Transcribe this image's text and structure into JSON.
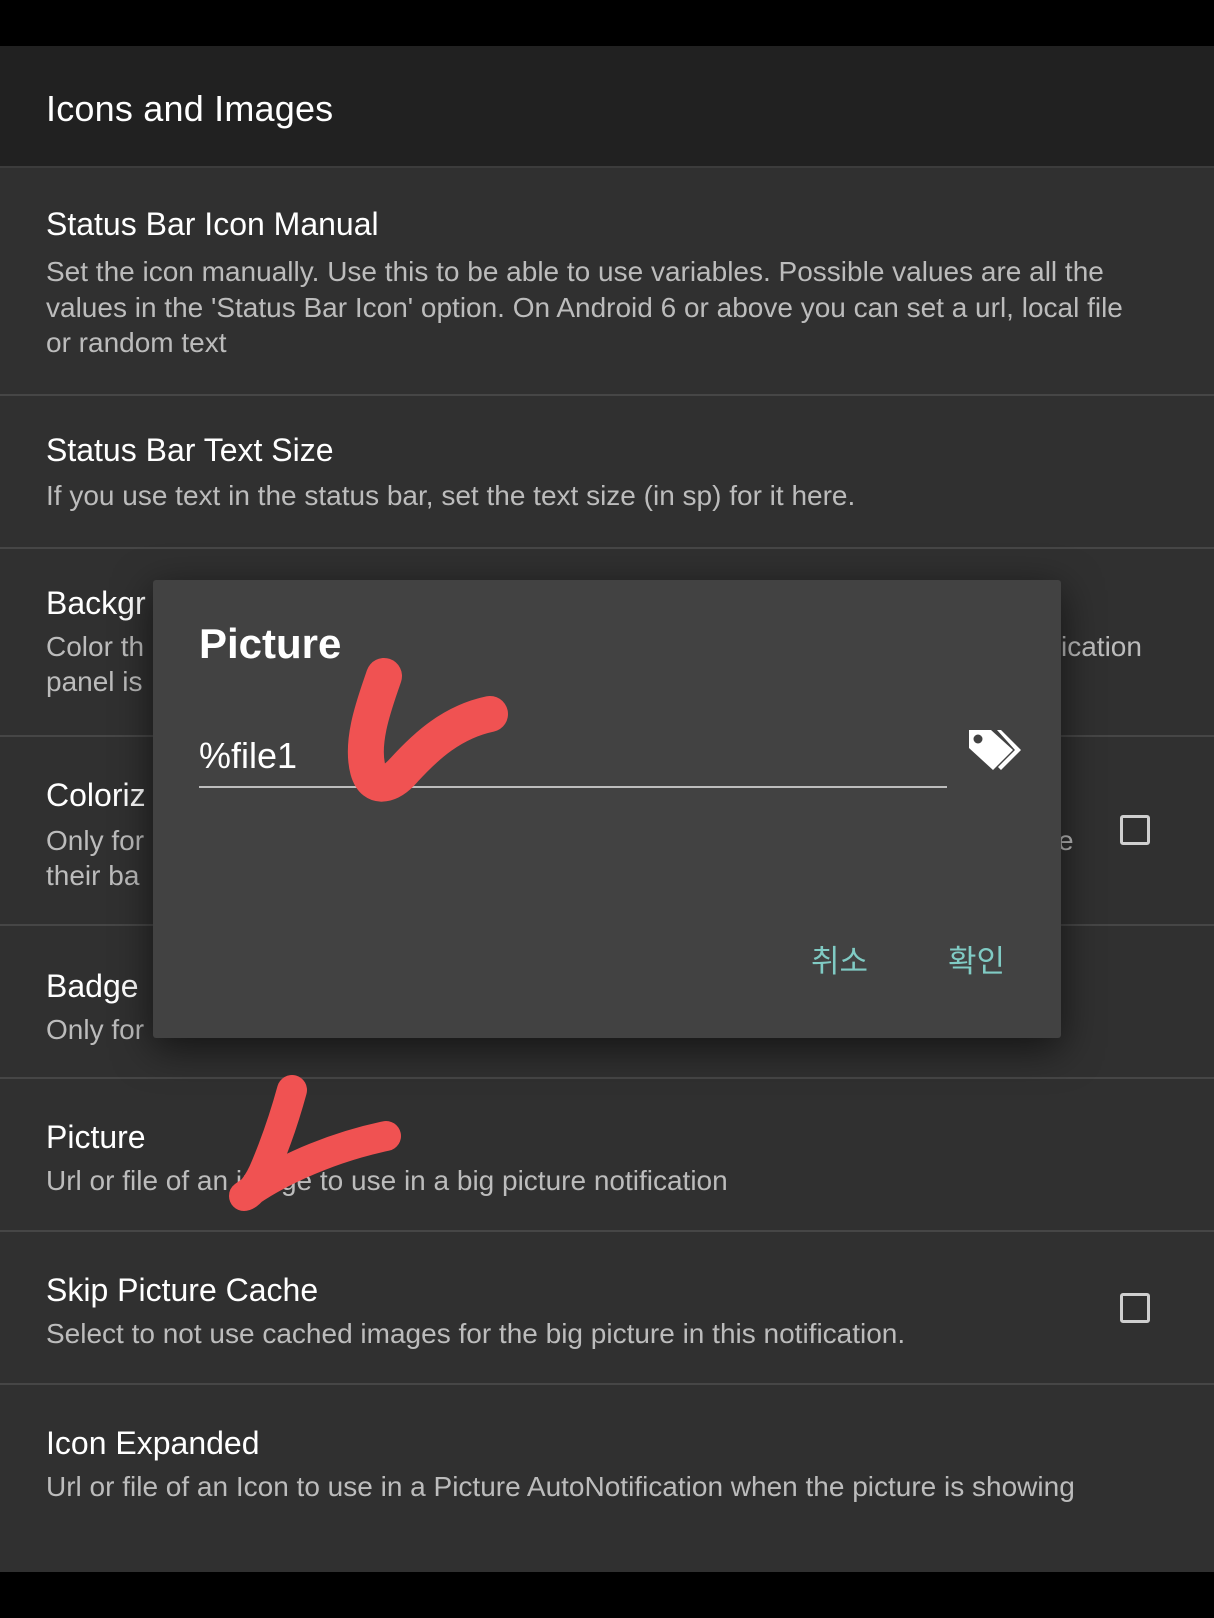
{
  "header": {
    "title": "Icons and Images"
  },
  "items": [
    {
      "title": "Status Bar Icon Manual",
      "summary": "Set the icon manually. Use this to be able to use variables. Possible values are all the values in the 'Status Bar Icon' option. On Android 6 or above you can set a url, local file or random text"
    },
    {
      "title": "Status Bar Text Size",
      "summary": "If you use text in the status bar, set the text size (in sp) for it here."
    },
    {
      "title_visible": "Backgr",
      "summary_line1_left": "Color th",
      "summary_line1_right": "ication",
      "summary_line2_left": "panel is"
    },
    {
      "title_visible": "Coloriz",
      "summary_line1_left": "Only for",
      "summary_line1_right": "e",
      "summary_line2_left": "their ba"
    },
    {
      "title_visible": "Badge",
      "summary_line1_left": "Only for"
    },
    {
      "title": "Picture",
      "summary": "Url or file of an image to use in a big picture notification"
    },
    {
      "title": "Skip Picture Cache",
      "summary": "Select to not use cached images for the big picture in this notification."
    },
    {
      "title": "Icon Expanded",
      "summary": "Url or file of an Icon to use in a Picture AutoNotification when the picture is showing"
    }
  ],
  "dialog": {
    "title": "Picture",
    "input_value": "%file1",
    "cancel_label": "취소",
    "ok_label": "확인"
  },
  "colors": {
    "accent": "#80cbc4",
    "annotation": "#f05252",
    "background": "#303030",
    "header": "#212121",
    "dialog": "#424242"
  },
  "icons": {
    "tag": "tags-icon",
    "checkbox": "checkbox-unchecked"
  }
}
